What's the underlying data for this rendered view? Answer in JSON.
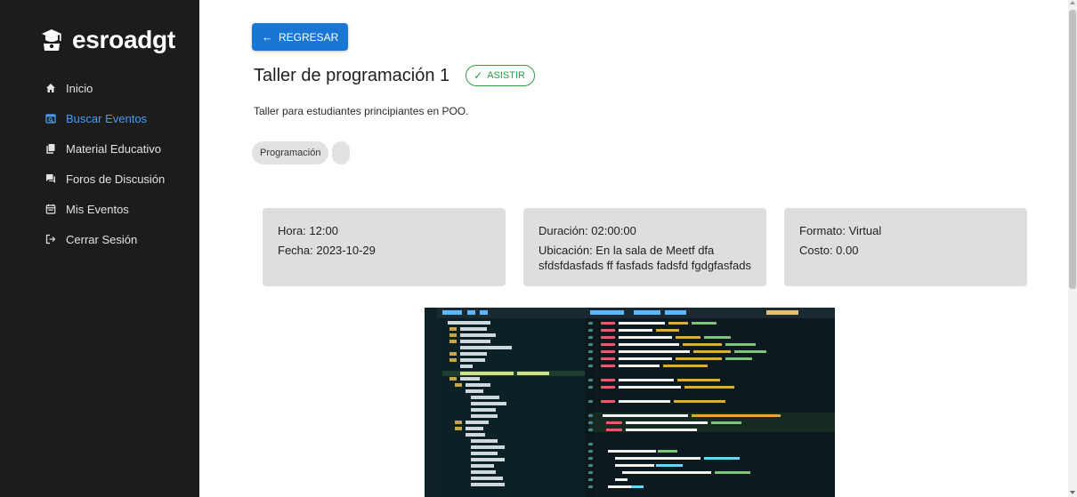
{
  "brand": {
    "name": "esroadgt",
    "icon": "graduation-cap-icon"
  },
  "nav": {
    "items": [
      {
        "label": "Inicio",
        "icon": "home-icon",
        "active": false
      },
      {
        "label": "Buscar Eventos",
        "icon": "search-events-icon",
        "active": true
      },
      {
        "label": "Material Educativo",
        "icon": "book-icon",
        "active": false
      },
      {
        "label": "Foros de Discusión",
        "icon": "forum-icon",
        "active": false
      },
      {
        "label": "Mis Eventos",
        "icon": "calendar-icon",
        "active": false
      },
      {
        "label": "Cerrar Sesión",
        "icon": "logout-icon",
        "active": false
      }
    ]
  },
  "event": {
    "back_label": "REGRESAR",
    "title": "Taller de programación 1",
    "assist_label": "ASISTIR",
    "description": "Taller para estudiantes principiantes en POO.",
    "tags": [
      "Programación",
      ""
    ],
    "details": {
      "hora": "Hora: 12:00",
      "fecha": "Fecha: 2023-10-29",
      "duracion": "Duración: 02:00:00",
      "ubicacion": "Ubicación: En la sala de Meetf dfa sfdsfdasfads ff fasfads fadsfd fgdgfasfads",
      "formato": "Formato: Virtual",
      "costo": "Costo: 0.00"
    }
  },
  "colors": {
    "sidebar_bg": "#1c1c1c",
    "accent": "#1976d2",
    "active_nav": "#4a9cf2",
    "success": "#2e9d44",
    "card_bg": "#dedede"
  }
}
